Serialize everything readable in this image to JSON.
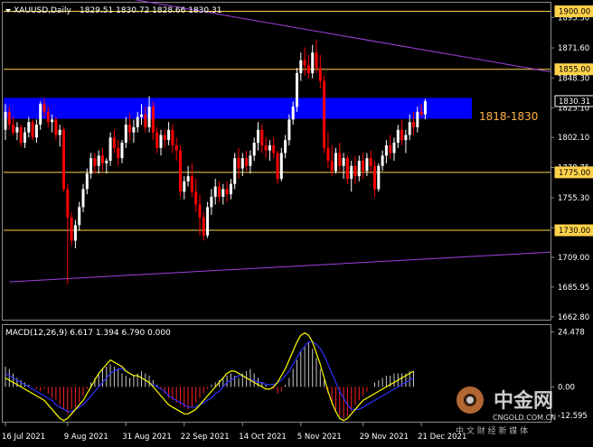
{
  "header": {
    "symbol_label": "XAUUSD,Daily",
    "ohlc": "1829.51 1830.72 1828.66 1830.31"
  },
  "price_axis_ticks": [
    "1895.30",
    "1871.60",
    "1848.30",
    "1825.10",
    "1802.10",
    "1778.75",
    "1755.30",
    "1732.00",
    "1709.00",
    "1685.95",
    "1662.80"
  ],
  "level_tags": [
    {
      "label": "1900.00",
      "value": 1900.0
    },
    {
      "label": "1855.00",
      "value": 1855.0
    },
    {
      "label": "1830.31",
      "value": 1830.31
    },
    {
      "label": "1775.00",
      "value": 1775.0
    },
    {
      "label": "1730.00",
      "value": 1730.0
    }
  ],
  "zone": {
    "label": "1818-1830",
    "low": 1818,
    "high": 1830
  },
  "macd": {
    "label": "MACD(12,26,9) 6.617 1.394 6.790 0.000",
    "axis_ticks": [
      "24.478",
      "0.00",
      "-12.595"
    ]
  },
  "date_ticks": [
    "16 Jul 2021",
    "9 Aug 2021",
    "31 Aug 2021",
    "22 Sep 2021",
    "14 Oct 2021",
    "5 Nov 2021",
    "29 Nov 2021",
    "21 Dec 2021"
  ],
  "watermark": {
    "brand_cn": "中金网",
    "domain": "CNGOLD.COM.CN",
    "slogan": "中 文 财 经 新 媒 体"
  },
  "colors": {
    "background": "#000000",
    "bull": "#ffffff",
    "bear": "#ff0000",
    "zone": "#0000ff",
    "level_line": "#ffd24a",
    "trendline": "#a040e0",
    "macd_line": "#ffff00",
    "signal_line": "#3030ff",
    "macd_hist_pos": "#c8c8c8",
    "macd_hist_neg": "#ff2020"
  },
  "chart_data": {
    "type": "candlestick",
    "title": "XAUUSD,Daily",
    "ylim": [
      1660.6,
      1906.7
    ],
    "candles": [
      [
        1808,
        1828,
        1800,
        1822
      ],
      [
        1822,
        1826,
        1808,
        1812
      ],
      [
        1812,
        1818,
        1804,
        1806
      ],
      [
        1806,
        1814,
        1800,
        1810
      ],
      [
        1810,
        1812,
        1795,
        1798
      ],
      [
        1798,
        1810,
        1794,
        1806
      ],
      [
        1806,
        1818,
        1802,
        1814
      ],
      [
        1814,
        1816,
        1800,
        1802
      ],
      [
        1802,
        1816,
        1798,
        1812
      ],
      [
        1812,
        1830,
        1808,
        1828
      ],
      [
        1828,
        1832,
        1818,
        1822
      ],
      [
        1822,
        1826,
        1810,
        1814
      ],
      [
        1814,
        1820,
        1806,
        1816
      ],
      [
        1816,
        1818,
        1800,
        1804
      ],
      [
        1804,
        1812,
        1795,
        1808
      ],
      [
        1808,
        1810,
        1760,
        1762
      ],
      [
        1762,
        1766,
        1688,
        1740
      ],
      [
        1740,
        1744,
        1718,
        1722
      ],
      [
        1722,
        1738,
        1716,
        1734
      ],
      [
        1734,
        1752,
        1730,
        1748
      ],
      [
        1748,
        1766,
        1744,
        1762
      ],
      [
        1762,
        1778,
        1758,
        1774
      ],
      [
        1774,
        1790,
        1770,
        1786
      ],
      [
        1786,
        1790,
        1774,
        1780
      ],
      [
        1780,
        1792,
        1774,
        1788
      ],
      [
        1788,
        1794,
        1776,
        1782
      ],
      [
        1782,
        1786,
        1774,
        1784
      ],
      [
        1784,
        1806,
        1780,
        1802
      ],
      [
        1802,
        1808,
        1790,
        1794
      ],
      [
        1794,
        1800,
        1780,
        1786
      ],
      [
        1786,
        1800,
        1782,
        1798
      ],
      [
        1798,
        1818,
        1794,
        1812
      ],
      [
        1812,
        1820,
        1800,
        1806
      ],
      [
        1806,
        1816,
        1798,
        1810
      ],
      [
        1810,
        1822,
        1806,
        1818
      ],
      [
        1818,
        1828,
        1812,
        1820
      ],
      [
        1820,
        1826,
        1806,
        1810
      ],
      [
        1810,
        1834,
        1806,
        1826
      ],
      [
        1826,
        1830,
        1800,
        1806
      ],
      [
        1806,
        1810,
        1790,
        1794
      ],
      [
        1794,
        1808,
        1788,
        1804
      ],
      [
        1804,
        1808,
        1794,
        1800
      ],
      [
        1800,
        1814,
        1796,
        1808
      ],
      [
        1808,
        1812,
        1790,
        1796
      ],
      [
        1796,
        1802,
        1784,
        1792
      ],
      [
        1792,
        1796,
        1756,
        1760
      ],
      [
        1760,
        1772,
        1754,
        1768
      ],
      [
        1768,
        1780,
        1764,
        1772
      ],
      [
        1772,
        1782,
        1756,
        1760
      ],
      [
        1760,
        1770,
        1744,
        1750
      ],
      [
        1750,
        1758,
        1726,
        1740
      ],
      [
        1740,
        1744,
        1722,
        1726
      ],
      [
        1726,
        1752,
        1724,
        1748
      ],
      [
        1748,
        1762,
        1742,
        1756
      ],
      [
        1756,
        1770,
        1750,
        1764
      ],
      [
        1764,
        1768,
        1752,
        1756
      ],
      [
        1756,
        1766,
        1750,
        1762
      ],
      [
        1762,
        1768,
        1752,
        1758
      ],
      [
        1758,
        1770,
        1754,
        1766
      ],
      [
        1766,
        1790,
        1762,
        1786
      ],
      [
        1786,
        1794,
        1770,
        1778
      ],
      [
        1778,
        1790,
        1772,
        1786
      ],
      [
        1786,
        1792,
        1776,
        1780
      ],
      [
        1780,
        1792,
        1774,
        1788
      ],
      [
        1788,
        1802,
        1784,
        1798
      ],
      [
        1798,
        1814,
        1792,
        1808
      ],
      [
        1808,
        1812,
        1790,
        1796
      ],
      [
        1796,
        1802,
        1786,
        1792
      ],
      [
        1792,
        1800,
        1784,
        1796
      ],
      [
        1796,
        1802,
        1786,
        1790
      ],
      [
        1790,
        1792,
        1766,
        1770
      ],
      [
        1770,
        1794,
        1768,
        1790
      ],
      [
        1790,
        1804,
        1786,
        1800
      ],
      [
        1800,
        1820,
        1796,
        1816
      ],
      [
        1816,
        1830,
        1812,
        1826
      ],
      [
        1826,
        1856,
        1822,
        1852
      ],
      [
        1852,
        1868,
        1846,
        1862
      ],
      [
        1862,
        1872,
        1850,
        1858
      ],
      [
        1858,
        1866,
        1848,
        1852
      ],
      [
        1852,
        1874,
        1848,
        1868
      ],
      [
        1868,
        1878,
        1852,
        1856
      ],
      [
        1856,
        1866,
        1840,
        1846
      ],
      [
        1846,
        1850,
        1790,
        1794
      ],
      [
        1794,
        1806,
        1778,
        1784
      ],
      [
        1784,
        1796,
        1772,
        1776
      ],
      [
        1776,
        1794,
        1774,
        1790
      ],
      [
        1790,
        1798,
        1776,
        1780
      ],
      [
        1780,
        1790,
        1770,
        1786
      ],
      [
        1786,
        1788,
        1766,
        1770
      ],
      [
        1770,
        1784,
        1760,
        1780
      ],
      [
        1780,
        1788,
        1766,
        1772
      ],
      [
        1772,
        1788,
        1768,
        1784
      ],
      [
        1784,
        1790,
        1770,
        1776
      ],
      [
        1776,
        1790,
        1772,
        1786
      ],
      [
        1786,
        1792,
        1774,
        1780
      ],
      [
        1780,
        1784,
        1756,
        1762
      ],
      [
        1762,
        1782,
        1760,
        1780
      ],
      [
        1780,
        1792,
        1776,
        1788
      ],
      [
        1788,
        1800,
        1782,
        1796
      ],
      [
        1796,
        1804,
        1786,
        1790
      ],
      [
        1790,
        1802,
        1784,
        1798
      ],
      [
        1798,
        1812,
        1794,
        1808
      ],
      [
        1808,
        1816,
        1796,
        1800
      ],
      [
        1800,
        1808,
        1790,
        1804
      ],
      [
        1804,
        1820,
        1800,
        1814
      ],
      [
        1814,
        1822,
        1804,
        1810
      ],
      [
        1810,
        1826,
        1806,
        1822
      ],
      [
        1822,
        1828,
        1818,
        1820
      ],
      [
        1820,
        1832,
        1816,
        1830.31
      ]
    ],
    "levels": [
      1900,
      1855,
      1830.31,
      1775,
      1730
    ],
    "zone": [
      1818,
      1830
    ],
    "trendlines": [
      {
        "from": [
          1,
          1926
        ],
        "to": [
          140,
          1853
        ]
      },
      {
        "from": [
          1,
          1690
        ],
        "to": [
          140,
          1713
        ]
      }
    ],
    "macd": {
      "ylim": [
        -15.5,
        27.5
      ],
      "histogram": [
        9,
        8,
        6,
        4,
        3,
        2,
        1,
        0,
        -1,
        -2,
        -1,
        -3,
        -5,
        -6,
        -8,
        -10,
        -12,
        -10,
        -9,
        -7,
        -4,
        -1,
        2,
        4,
        6,
        8,
        9,
        10,
        9,
        8,
        6,
        5,
        4,
        5,
        6,
        7,
        6,
        5,
        3,
        1,
        -1,
        -3,
        -5,
        -6,
        -7,
        -8,
        -9,
        -10,
        -9,
        -7,
        -5,
        -3,
        -1,
        1,
        2,
        3,
        4,
        5,
        6,
        5,
        4,
        6,
        7,
        8,
        6,
        4,
        2,
        1,
        0,
        -1,
        -3,
        -2,
        1,
        4,
        8,
        12,
        16,
        18,
        20,
        17,
        13,
        8,
        3,
        -3,
        -8,
        -11,
        -13,
        -14,
        -13,
        -11,
        -8,
        -6,
        -4,
        -2,
        0,
        2,
        3,
        4,
        5,
        5,
        6,
        6,
        6,
        6,
        7,
        7
      ],
      "macd_line": [
        4,
        3,
        2,
        1,
        0,
        -1,
        -2,
        -3,
        -4,
        -5,
        -6,
        -8,
        -10,
        -12,
        -14,
        -15,
        -14,
        -12,
        -10,
        -8,
        -6,
        -3,
        0,
        3,
        6,
        8,
        10,
        12,
        11,
        10,
        9,
        7,
        6,
        5,
        5,
        4,
        3,
        2,
        0,
        -2,
        -4,
        -6,
        -8,
        -9,
        -10,
        -11,
        -12,
        -12,
        -11,
        -10,
        -8,
        -6,
        -4,
        -2,
        0,
        2,
        4,
        6,
        7,
        7,
        6,
        5,
        4,
        3,
        2,
        1,
        0,
        -1,
        -1,
        0,
        2,
        5,
        8,
        12,
        16,
        20,
        23,
        24,
        23,
        20,
        15,
        10,
        4,
        -2,
        -7,
        -11,
        -14,
        -15,
        -14,
        -12,
        -10,
        -8,
        -6,
        -5,
        -4,
        -3,
        -2,
        -1,
        0,
        1,
        2,
        3,
        4,
        5,
        6,
        7
      ],
      "signal_line": [
        6,
        5,
        4,
        3,
        2,
        1,
        0,
        -1,
        -2,
        -3,
        -4,
        -5,
        -6,
        -8,
        -9,
        -10,
        -11,
        -11,
        -10,
        -9,
        -8,
        -6,
        -4,
        -2,
        0,
        2,
        4,
        6,
        7,
        8,
        8,
        7,
        6,
        5,
        5,
        4,
        3,
        2,
        1,
        0,
        -1,
        -2,
        -4,
        -5,
        -6,
        -7,
        -8,
        -9,
        -9,
        -9,
        -8,
        -7,
        -6,
        -5,
        -3,
        -2,
        0,
        2,
        3,
        4,
        5,
        5,
        4,
        3,
        3,
        2,
        2,
        1,
        1,
        1,
        2,
        3,
        5,
        7,
        10,
        13,
        16,
        18,
        20,
        20,
        19,
        17,
        14,
        10,
        6,
        2,
        -2,
        -5,
        -8,
        -10,
        -10,
        -10,
        -9,
        -8,
        -7,
        -6,
        -5,
        -4,
        -3,
        -2,
        -1,
        0,
        1,
        2,
        3,
        4
      ]
    }
  }
}
